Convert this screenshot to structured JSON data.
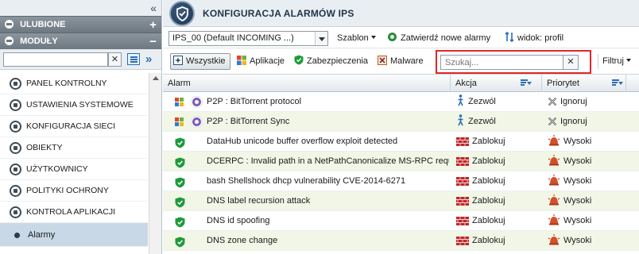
{
  "sidebar": {
    "favorites_label": "ULUBIONE",
    "modules_label": "MODUŁY",
    "search": {
      "value": "",
      "placeholder": ""
    },
    "items": [
      {
        "label": "PANEL KONTROLNY",
        "icon": "dashboard-icon"
      },
      {
        "label": "USTAWIENIA SYSTEMOWE",
        "icon": "system-settings-icon"
      },
      {
        "label": "KONFIGURACJA SIECI",
        "icon": "network-icon"
      },
      {
        "label": "OBIEKTY",
        "icon": "objects-icon"
      },
      {
        "label": "UŻYTKOWNICY",
        "icon": "users-icon"
      },
      {
        "label": "POLITYKI OCHRONY",
        "icon": "policy-icon"
      },
      {
        "label": "KONTROLA APLIKACJI",
        "icon": "app-control-icon"
      }
    ],
    "active_subitem": "Alarmy"
  },
  "header": {
    "title": "KONFIGURACJA ALARMÓW IPS"
  },
  "toolbar": {
    "policy_value": "IPS_00 (Default INCOMING ...)",
    "template_label": "Szablon",
    "approve_label": "Zatwierdź nowe alarmy",
    "view_label": "widok: profil"
  },
  "filters": {
    "all_label": "Wszystkie",
    "apps_label": "Aplikacje",
    "security_label": "Zabezpieczenia",
    "malware_label": "Malware",
    "search_placeholder": "Szukaj...",
    "filter_label": "Filtruj"
  },
  "grid": {
    "columns": {
      "alarm": "Alarm",
      "action": "Akcja",
      "priority": "Priorytet"
    },
    "rows": [
      {
        "type": "app",
        "name": "P2P : BitTorrent protocol",
        "action": "Zezwól",
        "priority": "Ignoruj"
      },
      {
        "type": "app",
        "name": "P2P : BitTorrent Sync",
        "action": "Zezwól",
        "priority": "Ignoruj"
      },
      {
        "type": "sec",
        "name": "DataHub unicode buffer overflow exploit detected",
        "action": "Zablokuj",
        "priority": "Wysoki"
      },
      {
        "type": "sec",
        "name": "DCERPC : Invalid path in a NetPathCanonicalize MS-RPC request",
        "action": "Zablokuj",
        "priority": "Wysoki"
      },
      {
        "type": "sec",
        "name": "bash Shellshock dhcp vulnerability CVE-2014-6271",
        "action": "Zablokuj",
        "priority": "Wysoki"
      },
      {
        "type": "sec",
        "name": "DNS label recursion attack",
        "action": "Zablokuj",
        "priority": "Wysoki"
      },
      {
        "type": "sec",
        "name": "DNS id spoofing",
        "action": "Zablokuj",
        "priority": "Wysoki"
      },
      {
        "type": "sec",
        "name": "DNS zone change",
        "action": "Zablokuj",
        "priority": "Wysoki"
      }
    ]
  },
  "colors": {
    "accent": "#2a6fb3",
    "highlight_border": "#e3262a",
    "allow": "#2a6fb3",
    "block": "#c0262a",
    "high": "#d2502a",
    "shield": "#1f9a3c"
  }
}
